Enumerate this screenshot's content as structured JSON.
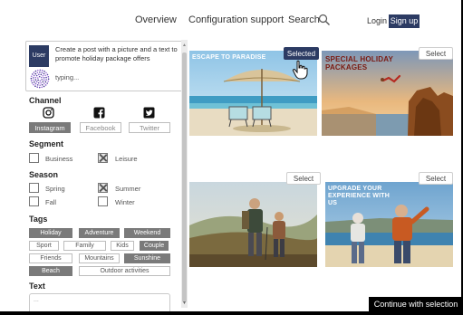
{
  "header": {
    "nav": [
      "Overview",
      "Configuration support",
      "Search"
    ],
    "login": "Login",
    "signup": "Sign up"
  },
  "chat": {
    "user_label": "User",
    "message": "Create a post with a picture and a text to promote holiday package offers",
    "status": "typing..."
  },
  "filters": {
    "channel": {
      "title": "Channel",
      "options": [
        {
          "label": "Instagram",
          "icon": "instagram-icon",
          "selected": true
        },
        {
          "label": "Facebook",
          "icon": "facebook-icon",
          "selected": false
        },
        {
          "label": "Twitter",
          "icon": "twitter-icon",
          "selected": false
        }
      ]
    },
    "segment": {
      "title": "Segment",
      "options": [
        {
          "label": "Business",
          "checked": false
        },
        {
          "label": "Leisure",
          "checked": true
        }
      ]
    },
    "season": {
      "title": "Season",
      "options": [
        {
          "label": "Spring",
          "checked": false
        },
        {
          "label": "Summer",
          "checked": true
        },
        {
          "label": "Fall",
          "checked": false
        },
        {
          "label": "Winter",
          "checked": false
        }
      ]
    },
    "tags": {
      "title": "Tags",
      "items": [
        {
          "label": "Holiday",
          "selected": true
        },
        {
          "label": "Adventure",
          "selected": true
        },
        {
          "label": "Weekend",
          "selected": true
        },
        {
          "label": "Sport",
          "selected": false
        },
        {
          "label": "Family",
          "selected": false
        },
        {
          "label": "Kids",
          "selected": false
        },
        {
          "label": "Couple",
          "selected": true
        },
        {
          "label": "Friends",
          "selected": false
        },
        {
          "label": "Mountains",
          "selected": false
        },
        {
          "label": "Sunshine",
          "selected": true
        },
        {
          "label": "Beach",
          "selected": true
        },
        {
          "label": "Outdoor activities",
          "selected": false
        }
      ]
    },
    "text": {
      "title": "Text",
      "placeholder": "..."
    }
  },
  "images": [
    {
      "caption": "ESCAPE TO PARADISE",
      "button": "Selected",
      "selected": true
    },
    {
      "caption": "SPECIAL HOLIDAY PACKAGES",
      "button": "Select",
      "selected": false
    },
    {
      "caption": "",
      "button": "Select",
      "selected": false
    },
    {
      "caption": "UPGRADE YOUR EXPERIENCE WITH US",
      "button": "Select",
      "selected": false
    }
  ],
  "continue_button": "Continue with selection",
  "colors": {
    "accent": "#2c3b63",
    "tag_selected": "#7a7a7a"
  }
}
